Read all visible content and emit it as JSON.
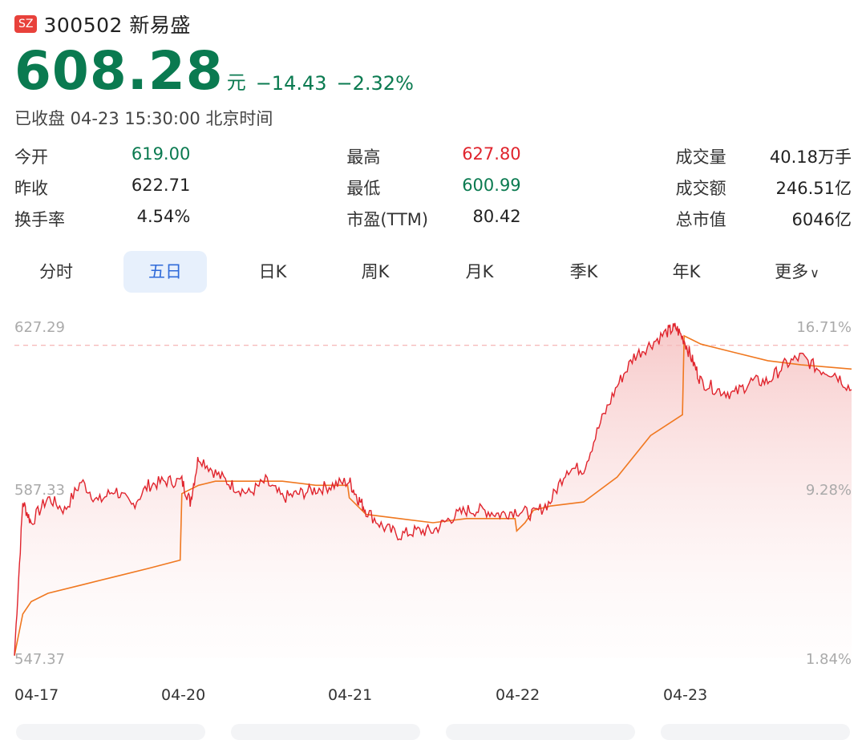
{
  "stock": {
    "exchange": "SZ",
    "title": "300502 新易盛",
    "price": "608.28",
    "unit": "元",
    "change": "−14.43",
    "change_pct": "−2.32%",
    "status": "已收盘 04-23 15:30:00 北京时间",
    "colors": {
      "down": "#0a7a50",
      "up": "#e0242d",
      "accent": "#2f6ad9"
    }
  },
  "stats": [
    [
      {
        "label": "今开",
        "value": "619.00",
        "tone": "green"
      },
      {
        "label": "最高",
        "value": "627.80",
        "tone": "red"
      },
      {
        "label": "成交量",
        "value": "40.18万手",
        "tone": ""
      }
    ],
    [
      {
        "label": "昨收",
        "value": "622.71",
        "tone": ""
      },
      {
        "label": "最低",
        "value": "600.99",
        "tone": "green"
      },
      {
        "label": "成交额",
        "value": "246.51亿",
        "tone": ""
      }
    ],
    [
      {
        "label": "换手率",
        "value": "4.54%",
        "tone": ""
      },
      {
        "label": "市盈(TTM)",
        "value": "80.42",
        "tone": ""
      },
      {
        "label": "总市值",
        "value": "6046亿",
        "tone": ""
      }
    ]
  ],
  "tabs": [
    "分时",
    "五日",
    "日K",
    "周K",
    "月K",
    "季K",
    "年K",
    "更多"
  ],
  "active_tab": "五日",
  "chart_data": {
    "type": "line",
    "y_left_labels": [
      "627.29",
      "587.33",
      "547.37"
    ],
    "y_right_labels": [
      "16.71%",
      "9.28%",
      "1.84%"
    ],
    "ylim": [
      547.37,
      627.29
    ],
    "prev_close": 622.71,
    "x_labels": [
      "04-17",
      "04-20",
      "04-21",
      "04-22",
      "04-23"
    ],
    "series": [
      {
        "color": "#e0242d",
        "x": [
          0,
          0.05,
          0.1,
          0.2,
          0.3,
          0.4,
          0.5,
          0.6,
          0.7,
          0.8,
          0.9,
          1.0,
          1.05,
          1.1,
          1.2,
          1.3,
          1.4,
          1.5,
          1.6,
          1.7,
          1.8,
          1.9,
          2.0,
          2.05,
          2.1,
          2.2,
          2.3,
          2.4,
          2.5,
          2.6,
          2.7,
          2.8,
          2.9,
          3.0,
          3.1,
          3.2,
          3.3,
          3.4,
          3.5,
          3.6,
          3.7,
          3.8,
          3.9,
          3.95,
          4.0,
          4.05,
          4.1,
          4.2,
          4.3,
          4.4,
          4.5,
          4.6,
          4.7,
          4.8,
          4.9,
          5.0
        ],
        "y": [
          548,
          585,
          580,
          586,
          583,
          590,
          585,
          588,
          584,
          589,
          590,
          590,
          585,
          596,
          592,
          589,
          587,
          590,
          586,
          587,
          588,
          589,
          590,
          586,
          583,
          579,
          577,
          578,
          578,
          581,
          583,
          583,
          582,
          583,
          582,
          585,
          593,
          593,
          604,
          613,
          620,
          623,
          626,
          627,
          624,
          619,
          614,
          612,
          611,
          614,
          614,
          618,
          620,
          617,
          616,
          612
        ]
      },
      {
        "color": "#f07820",
        "x": [
          0,
          0.05,
          0.1,
          0.2,
          0.4,
          0.6,
          0.8,
          0.99,
          1.0,
          1.05,
          1.1,
          1.2,
          1.4,
          1.6,
          1.8,
          1.99,
          2.0,
          2.05,
          2.1,
          2.3,
          2.5,
          2.7,
          2.99,
          3.0,
          3.05,
          3.1,
          3.2,
          3.4,
          3.6,
          3.8,
          3.99,
          4.0,
          4.05,
          4.1,
          4.3,
          4.5,
          4.7,
          5.0
        ],
        "y": [
          548,
          558,
          561,
          563,
          565,
          567,
          569,
          571,
          587,
          588,
          589,
          590,
          590,
          590,
          589,
          589,
          586,
          584,
          582,
          581,
          580,
          581,
          581,
          578,
          580,
          583,
          584,
          585,
          591,
          601,
          606,
          625,
          624,
          623,
          621,
          619,
          618,
          617
        ]
      }
    ]
  }
}
